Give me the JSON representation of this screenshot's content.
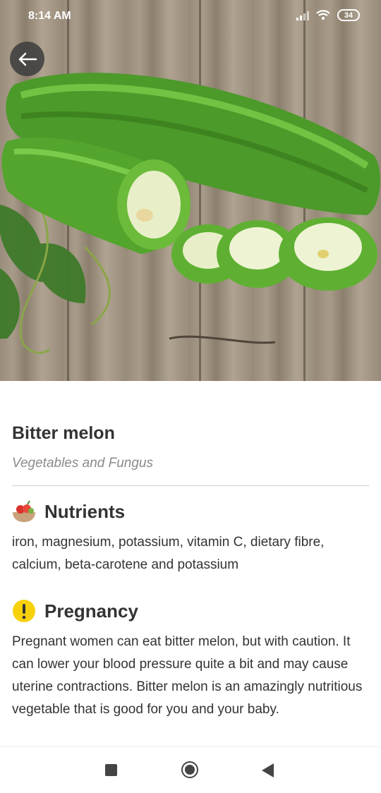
{
  "status_bar": {
    "time": "8:14 AM",
    "battery": "34"
  },
  "hero": {
    "icon": "back-arrow-icon"
  },
  "food": {
    "name": "Bitter melon",
    "category": "Vegetables and Fungus"
  },
  "nutrients": {
    "heading": "Nutrients",
    "icon": "fruit-bowl-icon",
    "text": "iron, magnesium, potassium, vitamin C, dietary fibre, calcium, beta-carotene and potassium"
  },
  "pregnancy": {
    "heading": "Pregnancy",
    "icon": "warning-exclamation-icon",
    "icon_color": "#f7d10c",
    "text": "Pregnant women can eat bitter melon, but with caution. It can lower your blood pressure quite a bit and may cause uterine contractions. Bitter melon is an amazingly nutritious vegetable that is good for you and your baby."
  },
  "nav_bar": {
    "buttons": [
      "recents-square-icon",
      "home-circle-icon",
      "back-triangle-icon"
    ]
  }
}
